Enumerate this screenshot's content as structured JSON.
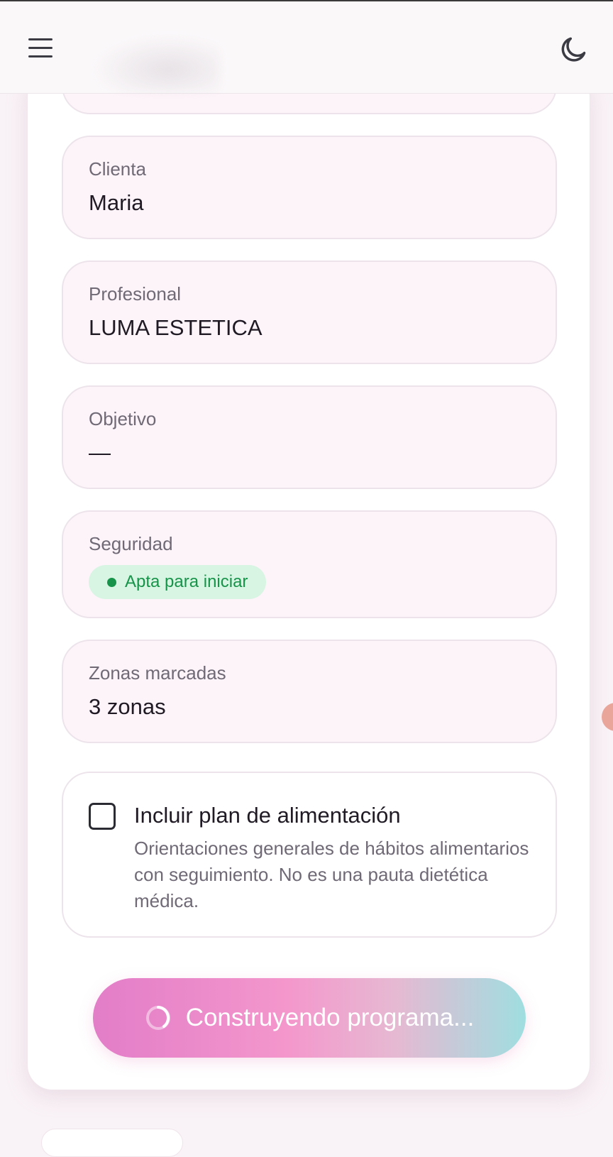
{
  "header": {
    "menu_icon": "hamburger-menu-icon",
    "theme_icon": "moon-icon"
  },
  "summary": {
    "client": {
      "label": "Clienta",
      "value": "Maria"
    },
    "professional": {
      "label": "Profesional",
      "value": "LUMA ESTETICA"
    },
    "objective": {
      "label": "Objetivo",
      "value": "—"
    },
    "safety": {
      "label": "Seguridad",
      "badge": "Apta para iniciar",
      "badge_color": "#18934a",
      "badge_bg": "#d7f5e2"
    },
    "zones": {
      "label": "Zonas marcadas",
      "value": "3 zonas"
    }
  },
  "nutrition_option": {
    "checked": false,
    "title": "Incluir plan de alimentación",
    "description": "Orientaciones generales de hábitos alimentarios con seguimiento. No es una pauta dietética médica."
  },
  "build_button": {
    "label": "Construyendo programa...",
    "state": "loading"
  },
  "colors": {
    "background": "#f9f2f6",
    "field_bg": "#fdf4f9",
    "gradient_start": "#e27dc8",
    "gradient_end": "#9fdee0"
  }
}
